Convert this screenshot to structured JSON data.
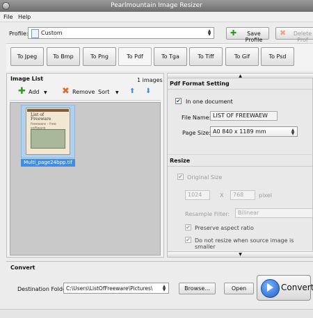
{
  "window": {
    "title": "Pearlmountain Image Resizer"
  },
  "menu": {
    "items": [
      "File",
      "Help"
    ]
  },
  "profile": {
    "label": "Profile:",
    "value": "Custom",
    "save_label": "Save Profile",
    "delete_label": "Delete Prof"
  },
  "formats": [
    "To Jpeg",
    "To Bmp",
    "To Png",
    "To Pdf",
    "To Tga",
    "To Tiff",
    "To Gif",
    "To Psd"
  ],
  "active_format": "To Pdf",
  "image_list": {
    "title": "Image List",
    "count": "1 images",
    "add_label": "Add",
    "remove_label": "Remove",
    "sort_label": "Sort",
    "thumbnail": {
      "filename": "Multi_page24bpp.tif",
      "page_title": "List of Freeware",
      "page_sub": "freeware - free software"
    }
  },
  "pdf_setting": {
    "title": "Pdf Format Setting",
    "one_document_label": "In one document",
    "one_document_checked": true,
    "file_name_label": "File Name:",
    "file_name_value": "LIST OF FREEWAEW",
    "page_size_label": "Page Size:",
    "page_size_value": "A0 840 x 1189 mm"
  },
  "resize": {
    "title": "Resize",
    "original_size_label": "Original Size",
    "original_size_checked": true,
    "width": "1024",
    "height": "768",
    "x_label": "X",
    "unit": "pixel",
    "resample_label": "Resample Filter:",
    "resample_value": "Bilinear",
    "preserve_label": "Preserve aspect ratio",
    "preserve_checked": true,
    "no_resize_label": "Do not resize when source image is smaller",
    "no_resize_checked": true
  },
  "convert": {
    "title": "Convert",
    "dest_label": "Destination Folder:",
    "dest_value": "C:\\Users\\ListOfFreeware\\Pictures\\",
    "browse_label": "Browse...",
    "open_label": "Open",
    "convert_label": "Convert"
  }
}
